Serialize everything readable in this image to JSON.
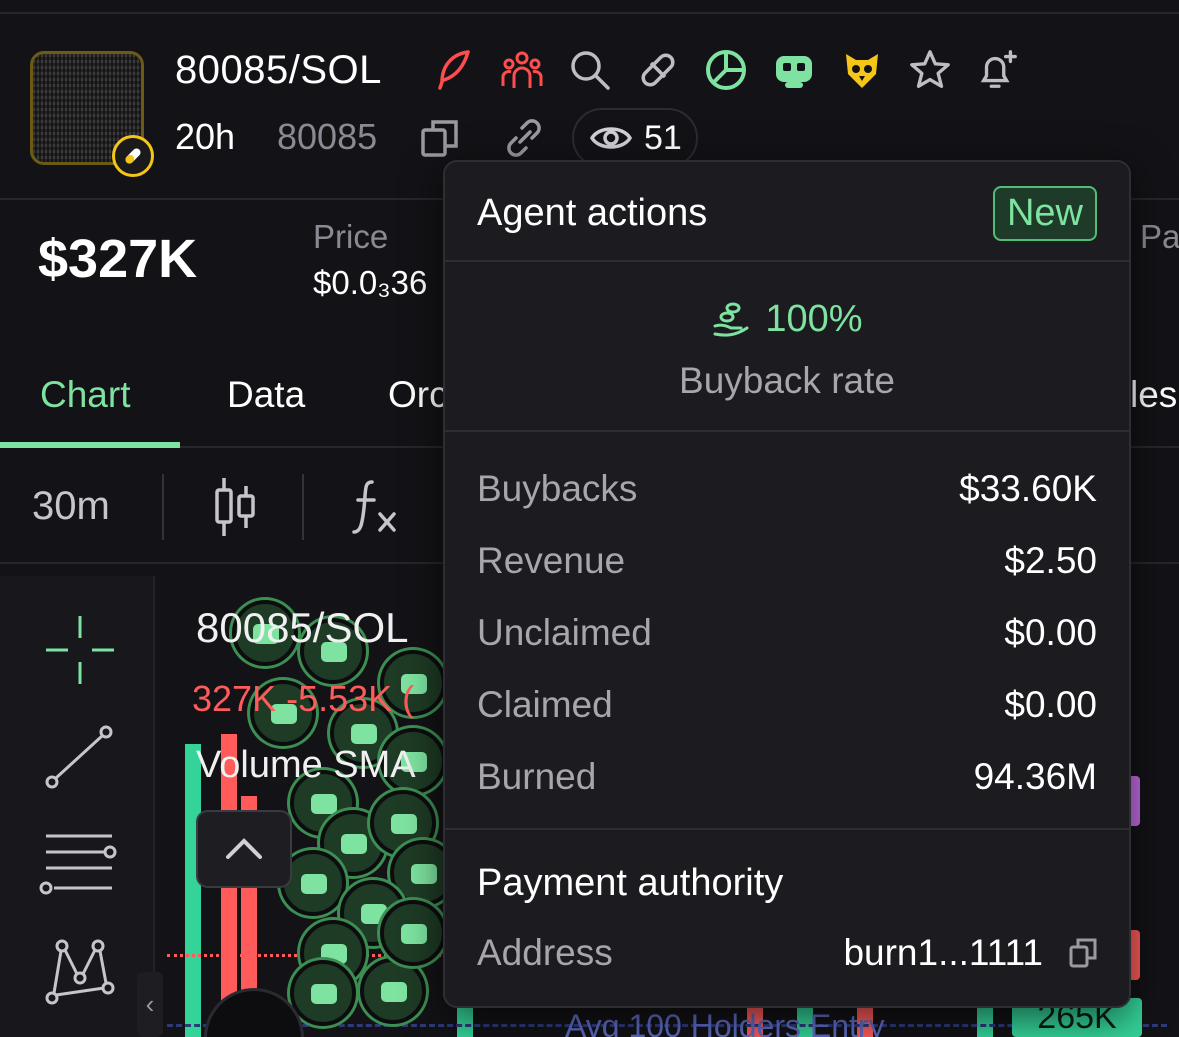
{
  "header": {
    "pair": "80085/SOL",
    "age": "20h",
    "ticker": "80085",
    "watchers": "51"
  },
  "stats": {
    "market_cap": "$327K",
    "price_label": "Price",
    "price_value": "$0.0₃36",
    "pa_label": "Pa"
  },
  "tabs": [
    {
      "label": "Chart",
      "active": true
    },
    {
      "label": "Data"
    },
    {
      "label": "Orc"
    },
    {
      "label": "les"
    }
  ],
  "toolbar": {
    "timeframe": "30m"
  },
  "chart": {
    "title": "80085/SOL",
    "values": "327K -5.53K (",
    "volume_label": "Volume SMA",
    "avg_label": "Avg 100 Holders Entry",
    "price_tag": "265K"
  },
  "popup": {
    "title": "Agent actions",
    "badge": "New",
    "buyback_rate": "100%",
    "buyback_rate_label": "Buyback rate",
    "rows": [
      {
        "label": "Buybacks",
        "value": "$33.60K"
      },
      {
        "label": "Revenue",
        "value": "$2.50"
      },
      {
        "label": "Unclaimed",
        "value": "$0.00"
      },
      {
        "label": "Claimed",
        "value": "$0.00"
      },
      {
        "label": "Burned",
        "value": "94.36M"
      }
    ],
    "payment_authority_title": "Payment authority",
    "address_label": "Address",
    "address_value": "burn1...1111"
  },
  "colors": {
    "accent_green": "#7ee3a0",
    "negative_red": "#ff5b5b",
    "background": "#131317"
  }
}
